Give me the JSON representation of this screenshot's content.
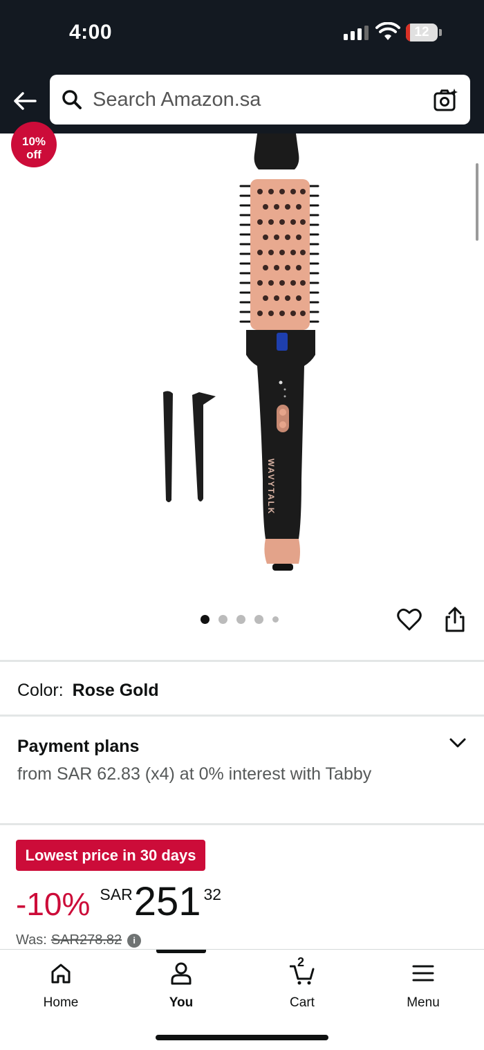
{
  "status_bar": {
    "time": "4:00",
    "battery": "12",
    "battery_level": 0.12,
    "battery_color": "#d93025"
  },
  "header": {
    "back_icon": "arrow-left-icon",
    "search_placeholder": "Search Amazon.sa",
    "camera_icon": "camera-search-icon",
    "background": "#131921"
  },
  "product": {
    "discount_badge_line1": "10%",
    "discount_badge_line2": "off",
    "image_dots_total": 5,
    "image_dots_active": 0,
    "brand_on_image": "WAVYTALK"
  },
  "actions": {
    "wishlist_icon": "heart-icon",
    "share_icon": "share-icon"
  },
  "color": {
    "label": "Color:",
    "value": "Rose Gold"
  },
  "payment": {
    "title": "Payment plans",
    "text": "from SAR 62.83 (x4) at 0% interest with Tabby",
    "expand_icon": "chevron-down-icon"
  },
  "pricing": {
    "deal_badge": "Lowest price in 30 days",
    "discount": "-10%",
    "currency": "SAR",
    "whole": "251",
    "fraction": "32",
    "was_label": "Was:",
    "was_price": "SAR278.82",
    "info_icon": "info-icon",
    "accent": "#cc0c39"
  },
  "bottom_nav": {
    "items": [
      {
        "label": "Home",
        "icon": "home-icon"
      },
      {
        "label": "You",
        "icon": "user-icon"
      },
      {
        "label": "Cart",
        "icon": "cart-icon"
      },
      {
        "label": "Menu",
        "icon": "menu-icon"
      }
    ],
    "active": 1,
    "cart_count": "2"
  }
}
